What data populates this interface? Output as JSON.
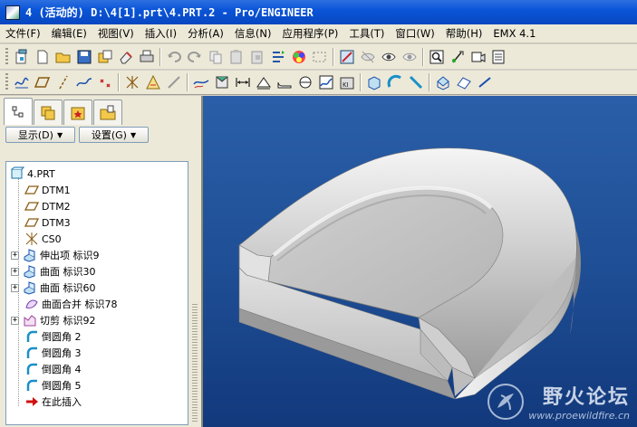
{
  "window": {
    "title": "4 (活动的) D:\\4[1].prt\\4.PRT.2 - Pro/ENGINEER"
  },
  "menu": {
    "items": [
      "文件(F)",
      "编辑(E)",
      "视图(V)",
      "插入(I)",
      "分析(A)",
      "信息(N)",
      "应用程序(P)",
      "工具(T)",
      "窗口(W)",
      "帮助(H)",
      "EMX 4.1"
    ]
  },
  "toolbar1": {
    "icons": [
      "new-icon",
      "open-icon",
      "save-icon",
      "save-copy-icon",
      "erase-icon",
      "print-icon",
      "undo-icon",
      "redo-icon",
      "copy-icon",
      "paste-icon",
      "paste-special-icon",
      "regenerate-icon",
      "appearance-icon",
      "selection-box-icon",
      "repaint-icon",
      "orient-icon",
      "named-view-icon",
      "zoom-window-icon",
      "spin-center-icon",
      "saved-views-icon",
      "layers-icon"
    ]
  },
  "toolbar2": {
    "icons": [
      "datum-curve-icon",
      "datum-plane-icon",
      "datum-axis-icon",
      "sketched-curve-icon",
      "datum-point-icon",
      "csys-icon",
      "analysis-icon",
      "sketch-icon",
      "style-curve-icon",
      "sweep-icon",
      "dimension-icon",
      "draft-icon",
      "round-icon",
      "shell-icon",
      "graph-icon",
      "kit-icon",
      "extrude-icon",
      "revolve-icon",
      "variable-sweep-icon",
      "blend-icon",
      "boundary-icon"
    ]
  },
  "panel": {
    "show_button": "显示(D)",
    "settings_button": "设置(G)",
    "tabs": [
      "model-tree-tab",
      "layer-tree-tab",
      "favorites-tab",
      "folder-browser-tab"
    ]
  },
  "tree": {
    "root": "4.PRT",
    "items": [
      {
        "label": "DTM1",
        "icon": "datum-plane-icon",
        "expandable": false
      },
      {
        "label": "DTM2",
        "icon": "datum-plane-icon",
        "expandable": false
      },
      {
        "label": "DTM3",
        "icon": "datum-plane-icon",
        "expandable": false
      },
      {
        "label": "CS0",
        "icon": "csys-icon",
        "expandable": false
      },
      {
        "label": "伸出项 标识9",
        "icon": "protrusion-icon",
        "expandable": true
      },
      {
        "label": "曲面 标识30",
        "icon": "surface-icon",
        "expandable": true
      },
      {
        "label": "曲面 标识60",
        "icon": "surface-icon",
        "expandable": true
      },
      {
        "label": "曲面合并 标识78",
        "icon": "merge-icon",
        "expandable": false
      },
      {
        "label": "切剪 标识92",
        "icon": "cut-icon",
        "expandable": true
      },
      {
        "label": "倒圆角 2",
        "icon": "round-icon",
        "expandable": false
      },
      {
        "label": "倒圆角 3",
        "icon": "round-icon",
        "expandable": false
      },
      {
        "label": "倒圆角 4",
        "icon": "round-icon",
        "expandable": false
      },
      {
        "label": "倒圆角 5",
        "icon": "round-icon",
        "expandable": false
      },
      {
        "label": "在此插入",
        "icon": "insert-here-arrow-icon",
        "expandable": false
      }
    ]
  },
  "watermark": {
    "title": "野火论坛",
    "url": "www.proewildfire.cn"
  },
  "colors": {
    "titlebar": "#0a55d8",
    "viewport_top": "#2a5fa8",
    "viewport_bottom": "#12397c",
    "model_surface": "#d8d8d8"
  }
}
